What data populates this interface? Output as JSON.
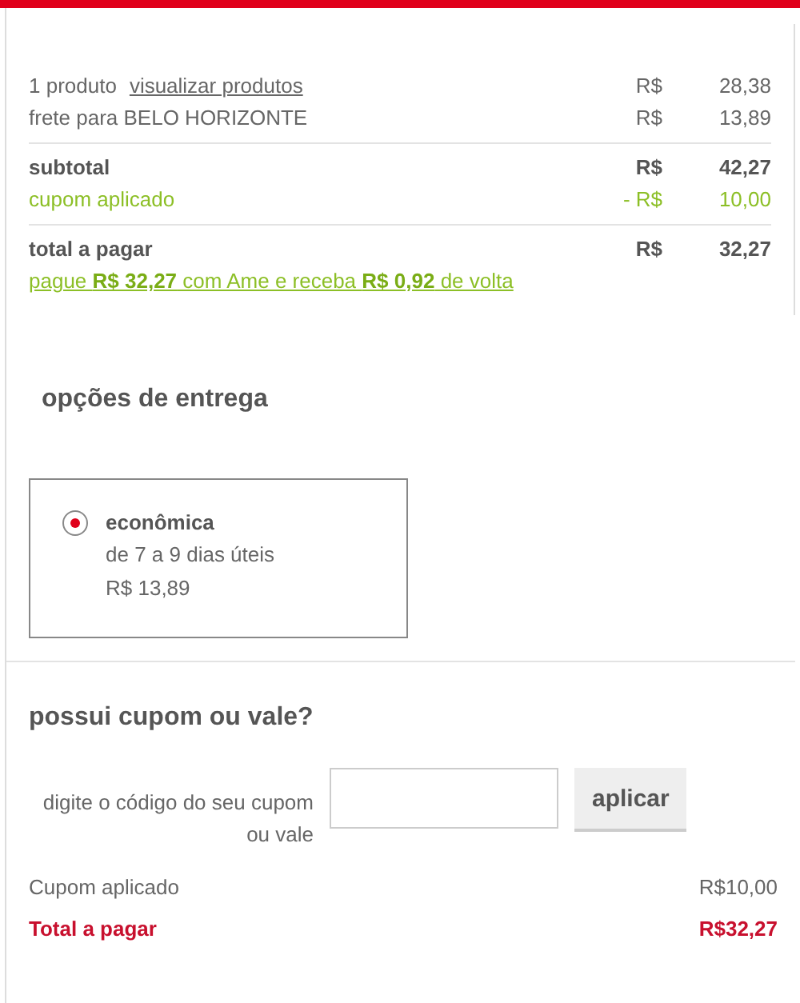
{
  "summary": {
    "groups": [
      {
        "rows": [
          {
            "kind": "plain",
            "label": "1 produto",
            "link": "visualizar produtos",
            "currency": "R$",
            "amount": "28,38"
          },
          {
            "kind": "plain",
            "label": "frete para BELO HORIZONTE",
            "currency": "R$",
            "amount": "13,89"
          }
        ]
      },
      {
        "rows": [
          {
            "kind": "bold",
            "label": "subtotal",
            "currency": "R$",
            "amount": "42,27"
          },
          {
            "kind": "discount",
            "label": "cupom aplicado",
            "currency": "- R$",
            "amount": "10,00"
          }
        ]
      },
      {
        "rows": [
          {
            "kind": "bold",
            "label": "total a pagar",
            "currency": "R$",
            "amount": "32,27"
          }
        ]
      }
    ],
    "promo": "pague **R$ 32,27** com Ame e receba **R$ 0,92** de volta"
  },
  "delivery": {
    "title": "opções de entrega",
    "options": [
      {
        "name": "econômica",
        "days": "de 7 a 9 dias úteis",
        "price": "R$ 13,89",
        "selected": true
      }
    ]
  },
  "coupon": {
    "title": "possui cupom ou vale?",
    "field_label": "digite o código do seu cupom ou vale",
    "button": "aplicar",
    "lines": [
      {
        "kind": "plain",
        "label": "Cupom aplicado",
        "value": "R$10,00"
      },
      {
        "kind": "total",
        "label": "Total a pagar",
        "value": "R$32,27"
      }
    ]
  }
}
